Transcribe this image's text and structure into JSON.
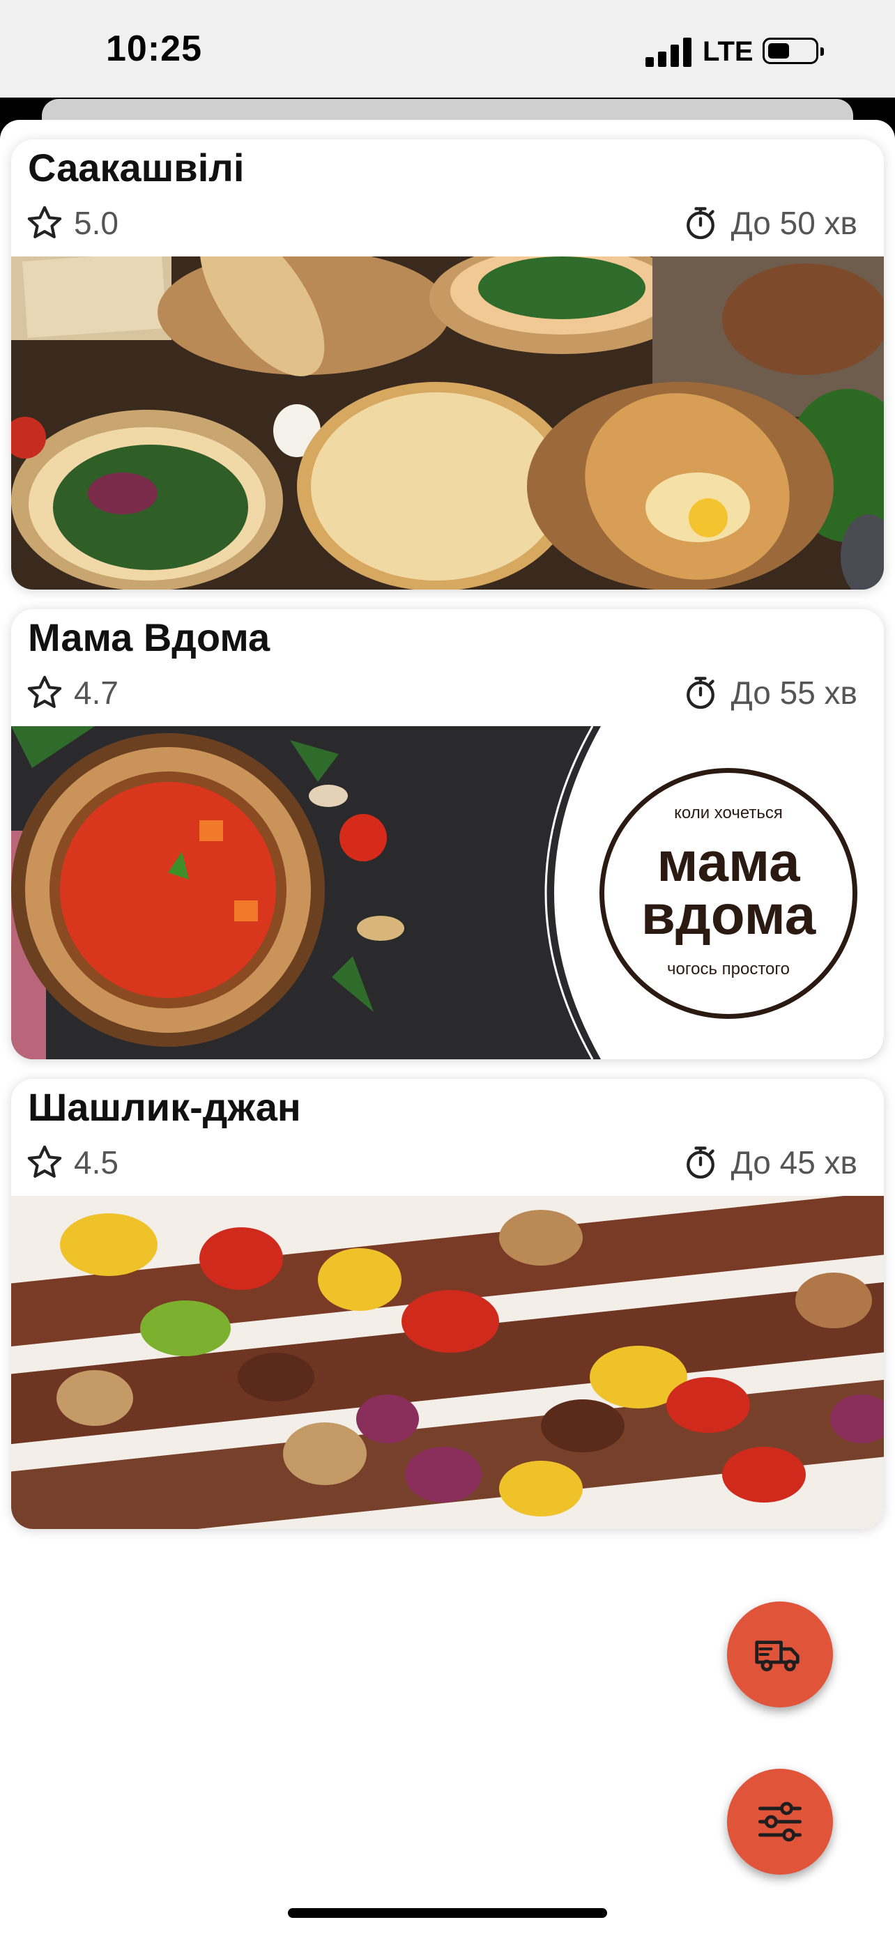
{
  "status_bar": {
    "time": "10:25",
    "network": "LTE",
    "battery_level": 0.4
  },
  "restaurants": [
    {
      "name": "Саакашвілі",
      "rating": "5.0",
      "delivery_time": "До 50 хв"
    },
    {
      "name": "Мама Вдома",
      "rating": "4.7",
      "delivery_time": "До 55 хв",
      "logo": {
        "top_text": "коли хочеться",
        "line1": "мама",
        "line2": "вдома",
        "bottom_text": "чогось простого"
      }
    },
    {
      "name": "Шашлик-джан",
      "rating": "4.5",
      "delivery_time": "До 45 хв"
    }
  ],
  "buttons": {
    "delivery": "delivery-truck-icon",
    "filters": "filter-sliders-icon"
  },
  "colors": {
    "accent": "#e0543a",
    "text": "#111111",
    "muted": "#555555"
  }
}
